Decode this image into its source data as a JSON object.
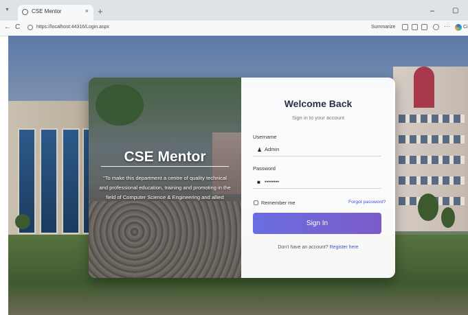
{
  "browser": {
    "tab_title": "CSE Mentor",
    "tab_close": "×",
    "new_tab": "+",
    "url": "https://localhost:44316/Login.aspx",
    "summarize": "Summarize",
    "more": "···",
    "profile_text": "Ci",
    "minimize": "–",
    "maximize": "▢",
    "back": "←",
    "reload": "C"
  },
  "brand": {
    "title": "CSE Mentor",
    "tagline": "\"To make this department a centre of quality technical and professional education, training and promoting in the field of Computer Science & Engineering and allied"
  },
  "login": {
    "title": "Welcome Back",
    "subtitle": "Sign in to your account",
    "username_label": "Username",
    "username_value": "Admin",
    "password_label": "Password",
    "password_value": "••••••••",
    "remember_label": "Remember me",
    "forgot_label": "Forgot password?",
    "signin_label": "Sign In",
    "footer_text": "Don't have an account?",
    "register_label": "Register here"
  },
  "colors": {
    "accent": "#6a6de0",
    "link": "#3d4fd6"
  }
}
